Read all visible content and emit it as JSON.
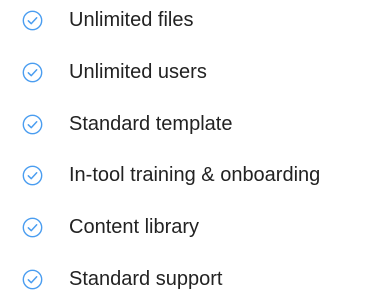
{
  "colors": {
    "check_accent": "#4a9df0",
    "text": "#222222"
  },
  "features": {
    "items": [
      {
        "icon": "check-circle-icon",
        "label": "Unlimited files"
      },
      {
        "icon": "check-circle-icon",
        "label": "Unlimited users"
      },
      {
        "icon": "check-circle-icon",
        "label": "Standard template"
      },
      {
        "icon": "check-circle-icon",
        "label": "In-tool training & onboarding"
      },
      {
        "icon": "check-circle-icon",
        "label": "Content library"
      },
      {
        "icon": "check-circle-icon",
        "label": "Standard support"
      }
    ]
  }
}
